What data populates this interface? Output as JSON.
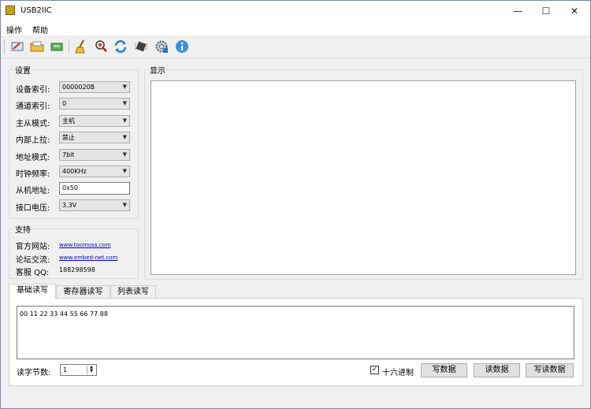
{
  "window": {
    "title": "USB2IIC",
    "controls": {
      "minimize": "—",
      "maximize": "☐",
      "close": "✕"
    }
  },
  "menu": [
    "操作",
    "帮助"
  ],
  "toolbar": {
    "buttons": [
      "connect-icon",
      "open-icon",
      "device-icon",
      "clear-icon",
      "search-icon",
      "refresh-icon",
      "chip-icon",
      "settings-icon",
      "info-icon"
    ]
  },
  "settings": {
    "title": "设置",
    "fields": [
      {
        "label": "设备索引:",
        "value": "0000020B"
      },
      {
        "label": "通道索引:",
        "value": "0"
      },
      {
        "label": "主从模式:",
        "value": "主机"
      },
      {
        "label": "内部上拉:",
        "value": "禁止"
      },
      {
        "label": "地址模式:",
        "value": "7bit"
      },
      {
        "label": "时钟频率:",
        "value": "400KHz"
      },
      {
        "label": "从机地址:",
        "value": "0x50"
      },
      {
        "label": "接口电压:",
        "value": "3.3V"
      }
    ]
  },
  "support": {
    "title": "支持",
    "website_label": "官方网站:",
    "website": "www.toomoss.com",
    "forum_label": "论坛交流:",
    "forum": "www.embed-net.com",
    "qq_label": "客服  QQ:",
    "qq": "188298598"
  },
  "display": {
    "title": "显示"
  },
  "tabs": [
    "基础读写",
    "寄存器读写",
    "列表读写"
  ],
  "basic": {
    "data": "00 11 22 33 44 55 66 77 88",
    "read_bytes_label": "读字节数:",
    "read_bytes": "1",
    "hex_label": "十六进制",
    "hex_checked": "✓",
    "write_button": "写数据",
    "read_button": "读数据",
    "write_read_button": "写读数据"
  }
}
